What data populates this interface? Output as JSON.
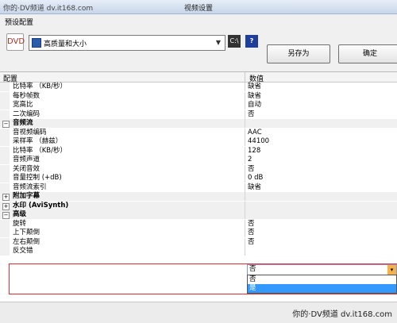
{
  "window": {
    "title": "视频设置",
    "watermark_top": "你的·DV频道 dv.it168.com"
  },
  "preset": {
    "group_label": "预设配置",
    "app_icon": "DVD",
    "selected": "高质量和大小",
    "cmd_button": "C:\\",
    "help_button": "?",
    "save_as": "另存为",
    "ok": "确定"
  },
  "grid": {
    "col_name": "配置",
    "col_value": "数值",
    "rows": [
      {
        "type": "prop",
        "name": "比特率 （KB/秒）",
        "value": "缺省"
      },
      {
        "type": "prop",
        "name": "每秒帧数",
        "value": "缺省"
      },
      {
        "type": "prop",
        "name": "宽高比",
        "value": "自动"
      },
      {
        "type": "prop",
        "name": "二次编码",
        "value": "否"
      },
      {
        "type": "cat",
        "sign": "−",
        "name": "音频流",
        "value": ""
      },
      {
        "type": "prop",
        "name": "音视频编码",
        "value": "AAC"
      },
      {
        "type": "prop",
        "name": "采样率 （赫兹）",
        "value": "44100"
      },
      {
        "type": "prop",
        "name": "比特率 （KB/秒）",
        "value": "128"
      },
      {
        "type": "prop",
        "name": "音频声道",
        "value": "2"
      },
      {
        "type": "prop",
        "name": "关闭音效",
        "value": "否"
      },
      {
        "type": "prop",
        "name": "音量控制 (+dB)",
        "value": "0 dB"
      },
      {
        "type": "prop",
        "name": "音频流索引",
        "value": "缺省"
      },
      {
        "type": "cat",
        "sign": "+",
        "name": "附加字幕",
        "value": ""
      },
      {
        "type": "cat",
        "sign": "+",
        "name": "水印 (AviSynth)",
        "value": ""
      },
      {
        "type": "cat",
        "sign": "−",
        "name": "高级",
        "value": ""
      },
      {
        "type": "prop",
        "name": "旋转",
        "value": "否"
      },
      {
        "type": "prop",
        "name": "上下颠倒",
        "value": "否"
      },
      {
        "type": "prop",
        "name": "左右颠倒",
        "value": "否"
      },
      {
        "type": "prop",
        "name": "反交错",
        "value": ""
      }
    ]
  },
  "dropdown": {
    "current": "否",
    "arrow": "▾",
    "options": [
      "否",
      "是"
    ]
  },
  "footer": {
    "watermark": "你的·DV频道 dv.it168.com"
  }
}
